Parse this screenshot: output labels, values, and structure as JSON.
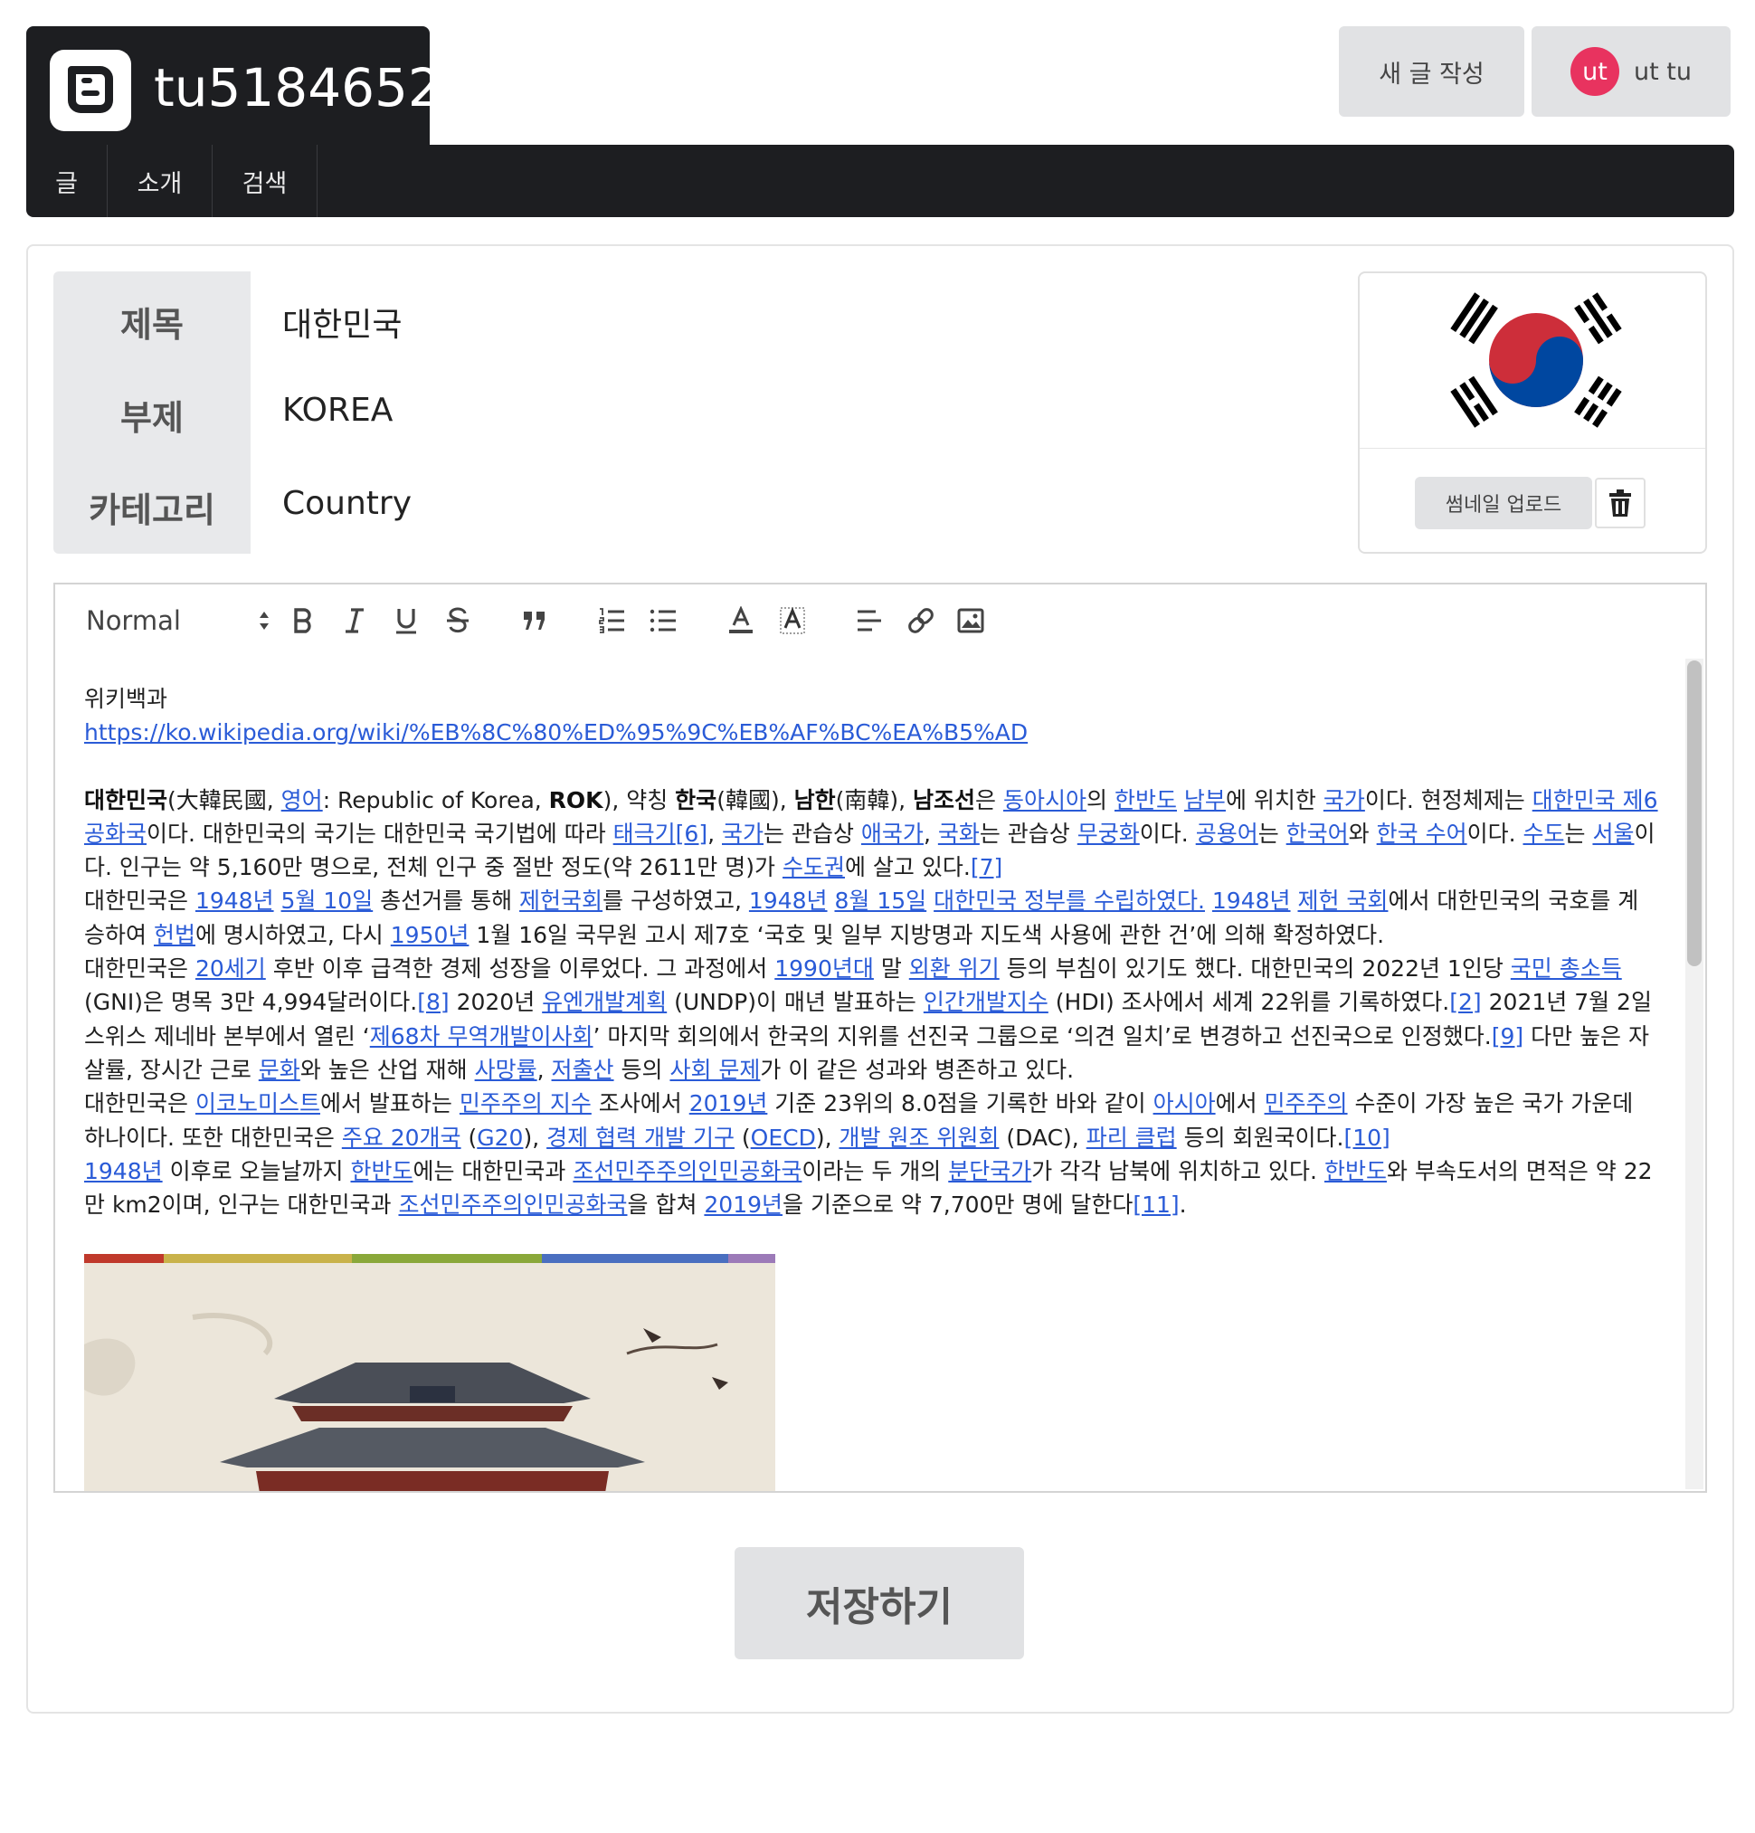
{
  "header": {
    "blog_title": "tu5184652",
    "new_post_label": "새 글 작성",
    "avatar_initials": "ut",
    "user_name": "ut tu",
    "avatar_color": "#e8335f"
  },
  "nav": {
    "items": [
      {
        "label": "글"
      },
      {
        "label": "소개"
      },
      {
        "label": "검색"
      }
    ]
  },
  "post": {
    "title_label": "제목",
    "title_value": "대한민국",
    "subtitle_label": "부제",
    "subtitle_value": "KOREA",
    "category_label": "카테고리",
    "category_value": "Country"
  },
  "thumbnail": {
    "upload_label": "썸네일 업로드",
    "delete_icon": "trash-icon"
  },
  "toolbar": {
    "format_value": "Normal"
  },
  "editor": {
    "source_name": "위키백과",
    "source_url": "https://ko.wikipedia.org/wiki/%EB%8C%80%ED%95%9C%EB%AF%BC%EA%B5%AD"
  },
  "save_label": "저장하기"
}
